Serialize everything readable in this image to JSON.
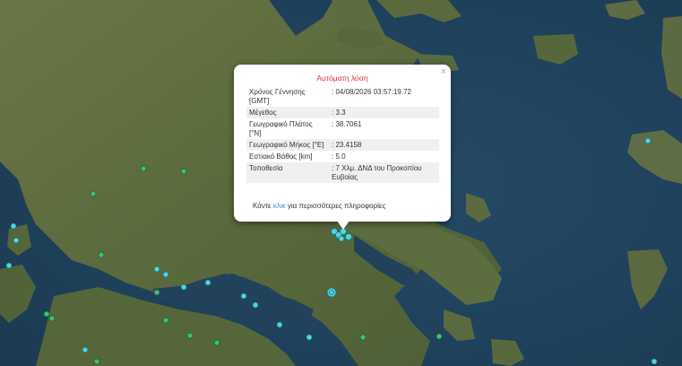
{
  "popup": {
    "title": "Αυτόματη λύση",
    "close_icon": "×",
    "rows": [
      {
        "label": "Χρόνος Γέννησης [GMT]",
        "value": ": 04/08/2026 03:57:19.72"
      },
      {
        "label": "Μέγεθος",
        "value": ": 3.3"
      },
      {
        "label": "Γεωγραφικό Πλάτος [°N]",
        "value": ": 38.7061"
      },
      {
        "label": "Γεωγραφικό Μήκος [°E]",
        "value": ": 23.4158"
      },
      {
        "label": "Εστιακό Βάθος [km]",
        "value": ": 5.0"
      },
      {
        "label": "Τοποθεσία",
        "value": ": 7 Χλμ. ΔΝΔ του Προκοπίου Ευβοίας"
      }
    ],
    "more_prefix": "Κάντε ",
    "more_link": "κλικ",
    "more_suffix": " για περισσότερες πληροφορίες"
  },
  "map": {
    "sea_color": "#21415a",
    "land_color": "#5d6b3e",
    "marker_colors": {
      "recent": "#4fd6e0",
      "older": "#3cc07a"
    }
  }
}
